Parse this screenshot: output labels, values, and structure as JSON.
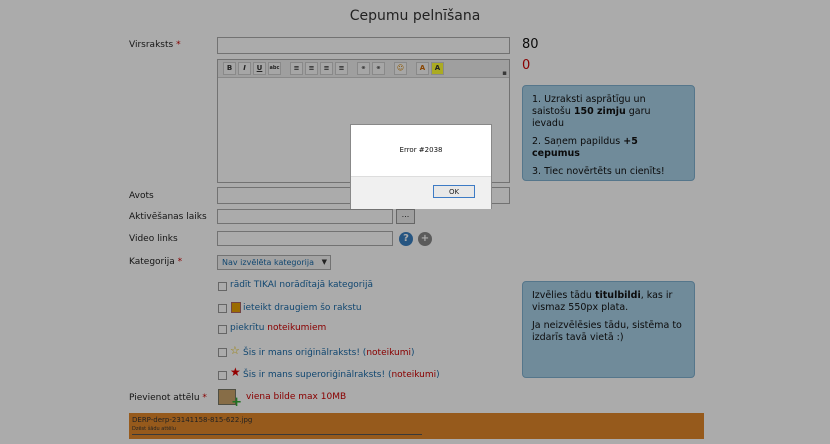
{
  "page_title": "Cepumu pelnīšana",
  "fields": {
    "headline_label": "Virsraksts",
    "required_mark": "*",
    "headline_counter": "80",
    "body_counter": "0",
    "source_label": "Avots",
    "activation_label": "Aktivēšanas laiks",
    "activation_button": "...",
    "video_label": "Video links",
    "category_label": "Kategorija",
    "category_value": "Nav izvēlēta kategorija",
    "image_label": "Pievienot attēlu",
    "image_hint": "viena bilde max 10MB"
  },
  "toolbar": [
    "B",
    "I",
    "U",
    "abc",
    "≡",
    "≡",
    "≡",
    "≡",
    "☷",
    "⚭",
    "⚭",
    "☺",
    "A",
    "A"
  ],
  "info_box_1": {
    "line1_pre": "1. Uzraksti asprātīgu un saistošu ",
    "line1_bold": "150 zimju",
    "line1_post": " garu ievadu",
    "line2_pre": "2. Saņem papildus ",
    "line2_bold": "+5 cepumus",
    "line3": "3. Tiec novērtēts un cienīts!"
  },
  "info_box_2": {
    "line1_pre": "Izvēlies tādu ",
    "line1_bold": "titulbildi",
    "line1_post": ", kas ir vismaz 550px plata.",
    "line2": "Ja neizvēlēsies tādu, sistēma to izdarīs tavā vietā :)"
  },
  "options": {
    "only_category": "rādīt TIKAI norādītajā kategorijā",
    "recommend": "ieteikt draugiem šo rakstu",
    "agree_pre": "piekrītu ",
    "agree_link": "noteikumiem",
    "original_pre": "Šis ir mans oriģinālraksts! (",
    "original_link": "noteikumi",
    "original_post": ")",
    "superoriginal_pre": "Šis ir mans superoriģinālraksts! (",
    "superoriginal_link": "noteikumi",
    "superoriginal_post": ")"
  },
  "upload": {
    "filename": "DERP-derp-23141158-815-622.jpg",
    "sub": "Dzēst šādu attēlu"
  },
  "dialog": {
    "message": "Error #2038",
    "ok_label": "OK"
  },
  "colors": {
    "accent": "#1a6aa8",
    "required": "#cc0000",
    "info_bg": "#a8cfe6",
    "upload_bar": "#e0862a"
  }
}
